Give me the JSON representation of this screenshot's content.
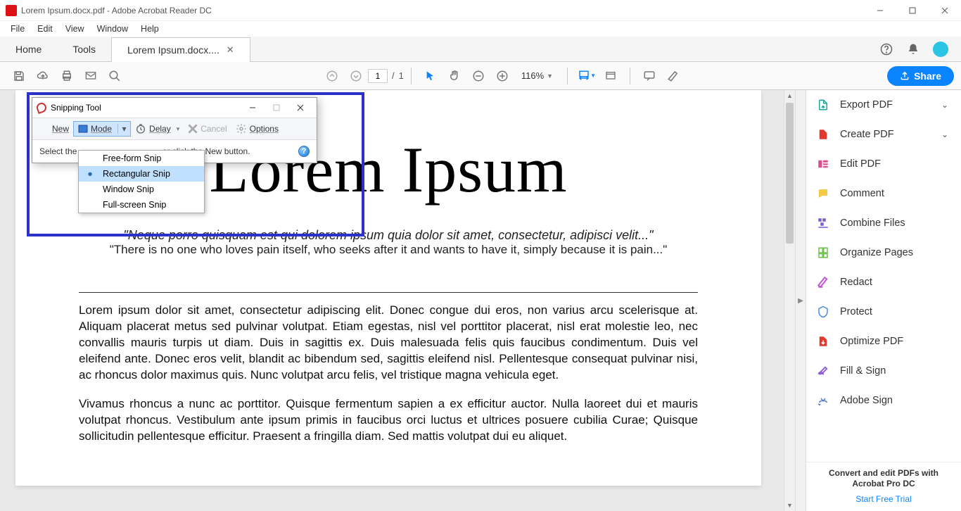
{
  "window": {
    "title": "Lorem Ipsum.docx.pdf - Adobe Acrobat Reader DC"
  },
  "menubar": [
    "File",
    "Edit",
    "View",
    "Window",
    "Help"
  ],
  "tabs": {
    "home": "Home",
    "tools": "Tools",
    "doc": "Lorem Ipsum.docx...."
  },
  "toolbar": {
    "page_current": "1",
    "page_sep": "/",
    "page_total": "1",
    "zoom": "116%",
    "share": "Share"
  },
  "doc": {
    "title": "Lorem Ipsum",
    "sub1": "\"Neque porro quisquam est qui dolorem ipsum quia dolor sit amet, consectetur, adipisci velit...\"",
    "sub2": "\"There is no one who loves pain itself, who seeks after it and wants to have it, simply because it is pain...\"",
    "p1": "Lorem ipsum dolor sit amet, consectetur adipiscing elit. Donec congue dui eros, non varius arcu scelerisque at. Aliquam placerat metus sed pulvinar volutpat. Etiam egestas, nisl vel porttitor placerat, nisl erat molestie leo, nec convallis mauris turpis ut diam. Duis in sagittis ex. Duis malesuada felis quis faucibus condimentum. Duis vel eleifend ante. Donec eros velit, blandit ac bibendum sed, sagittis eleifend nisl. Pellentesque consequat pulvinar nisi, ac rhoncus dolor maximus quis. Nunc volutpat arcu felis, vel tristique magna vehicula eget.",
    "p2": "Vivamus rhoncus a nunc ac porttitor. Quisque fermentum sapien a ex efficitur auctor. Nulla laoreet dui et mauris volutpat rhoncus. Vestibulum ante ipsum primis in faucibus orci luctus et ultrices posuere cubilia Curae; Quisque sollicitudin pellentesque efficitur. Praesent a fringilla diam. Sed mattis volutpat dui eu aliquet."
  },
  "rpanel": {
    "items": [
      {
        "label": "Export PDF",
        "chev": true
      },
      {
        "label": "Create PDF",
        "chev": true
      },
      {
        "label": "Edit PDF",
        "chev": false
      },
      {
        "label": "Comment",
        "chev": false
      },
      {
        "label": "Combine Files",
        "chev": false
      },
      {
        "label": "Organize Pages",
        "chev": false
      },
      {
        "label": "Redact",
        "chev": false
      },
      {
        "label": "Protect",
        "chev": false
      },
      {
        "label": "Optimize PDF",
        "chev": false
      },
      {
        "label": "Fill & Sign",
        "chev": false
      },
      {
        "label": "Adobe Sign",
        "chev": false
      }
    ],
    "promo": "Convert and edit PDFs with Acrobat Pro DC",
    "trial": "Start Free Trial"
  },
  "snip": {
    "title": "Snipping Tool",
    "new": "New",
    "mode": "Mode",
    "delay": "Delay",
    "cancel": "Cancel",
    "options": "Options",
    "status_pre": "Select the ",
    "status_post": " or click the New button.",
    "menu": [
      "Free-form Snip",
      "Rectangular Snip",
      "Window Snip",
      "Full-screen Snip"
    ],
    "selected_idx": 1
  }
}
